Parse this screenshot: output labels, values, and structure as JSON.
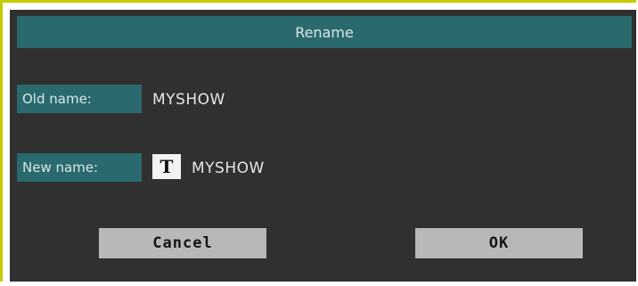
{
  "dialog": {
    "title": "Rename"
  },
  "old_name": {
    "label": "Old name:",
    "value": "MYSHOW"
  },
  "new_name": {
    "label": "New name:",
    "icon": "text-edit-icon",
    "icon_glyph": "T",
    "value": "MYSHOW"
  },
  "buttons": {
    "cancel": "Cancel",
    "ok": "OK"
  },
  "colors": {
    "accent_border": "#c7cc00",
    "panel": "#303030",
    "header": "#2a6a6e",
    "button": "#b8b8b8"
  }
}
